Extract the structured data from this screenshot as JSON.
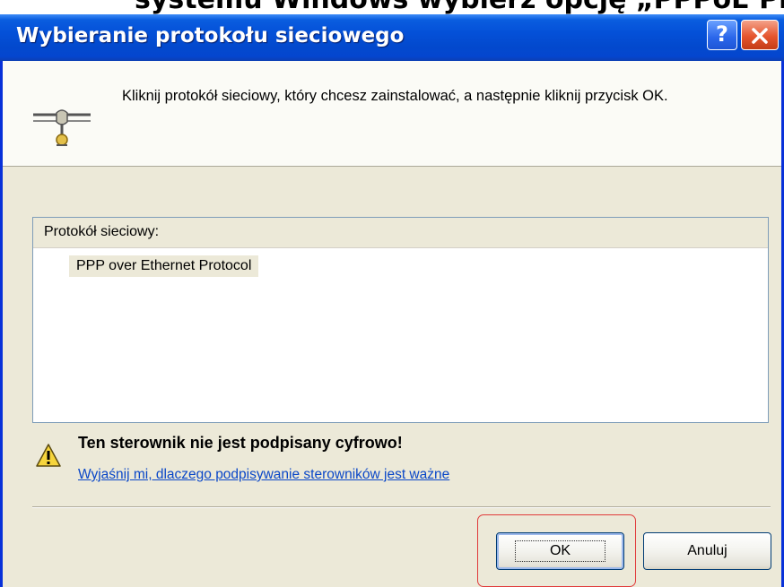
{
  "caption": {
    "text": "systemu Windows wybierz opcję „PPPoE Protocol” a następnie kliknij"
  },
  "titlebar": {
    "title": "Wybieranie protokołu sieciowego",
    "help_label": "?"
  },
  "header": {
    "icon": "network-protocol-icon",
    "instruction": "Kliknij protokół sieciowy, który chcesz zainstalować, a następnie kliknij przycisk OK."
  },
  "listbox": {
    "header_label": "Protokół sieciowy:",
    "items": [
      {
        "label": "PPP over Ethernet Protocol"
      }
    ]
  },
  "warning": {
    "icon": "warning-icon",
    "title": "Ten sterownik nie jest podpisany cyfrowo!",
    "link": "Wyjaśnij mi, dlaczego podpisywanie sterowników jest ważne"
  },
  "buttons": {
    "ok_label": "OK",
    "cancel_label": "Anuluj"
  },
  "colors": {
    "titlebar": "#0450d8",
    "dialog_bg": "#ece9d8",
    "link": "#0a47c8",
    "highlight": "#e03a3a"
  }
}
